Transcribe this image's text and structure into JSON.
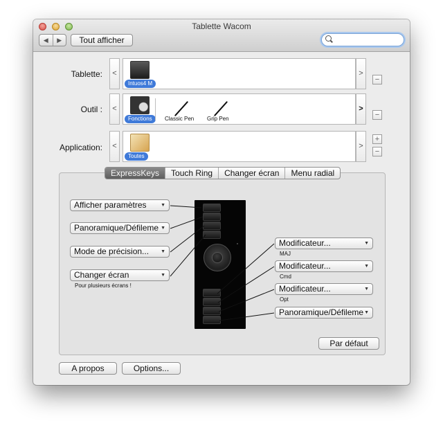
{
  "window": {
    "title": "Tablette Wacom"
  },
  "toolbar": {
    "back_label": "◀",
    "forward_label": "▶",
    "show_all_label": "Tout afficher",
    "search_value": ""
  },
  "rows": {
    "tablet": {
      "label": "Tablette:",
      "items": [
        {
          "label": "Intuos4 M"
        }
      ]
    },
    "tool": {
      "label": "Outil :",
      "items": [
        {
          "label": "Fonctions"
        },
        {
          "label": "Classic Pen"
        },
        {
          "label": "Grip Pen"
        }
      ]
    },
    "application": {
      "label": "Application:",
      "items": [
        {
          "label": "Toutes"
        }
      ]
    }
  },
  "nav": {
    "prev": "<",
    "next": ">",
    "add": "+",
    "remove": "−"
  },
  "tabs": [
    {
      "label": "ExpressKeys",
      "selected": true
    },
    {
      "label": "Touch Ring",
      "selected": false
    },
    {
      "label": "Changer écran",
      "selected": false
    },
    {
      "label": "Menu radial",
      "selected": false
    }
  ],
  "left_keys": [
    {
      "value": "Afficher paramètres"
    },
    {
      "value": "Panoramique/Défileme"
    },
    {
      "value": "Mode de précision..."
    },
    {
      "value": "Changer écran",
      "note": "Pour plusieurs écrans !"
    }
  ],
  "right_keys": [
    {
      "value": "Modificateur...",
      "note": "MAJ"
    },
    {
      "value": "Modificateur...",
      "note": "Cmd"
    },
    {
      "value": "Modificateur...",
      "note": "Opt"
    },
    {
      "value": "Panoramique/Défileme"
    }
  ],
  "dropdown_chevron": "▼",
  "buttons": {
    "defaults": "Par défaut",
    "about": "A propos",
    "options": "Options..."
  },
  "colors": {
    "selection_pill": "#3f7ad9",
    "search_focus": "#a9c8ee"
  }
}
